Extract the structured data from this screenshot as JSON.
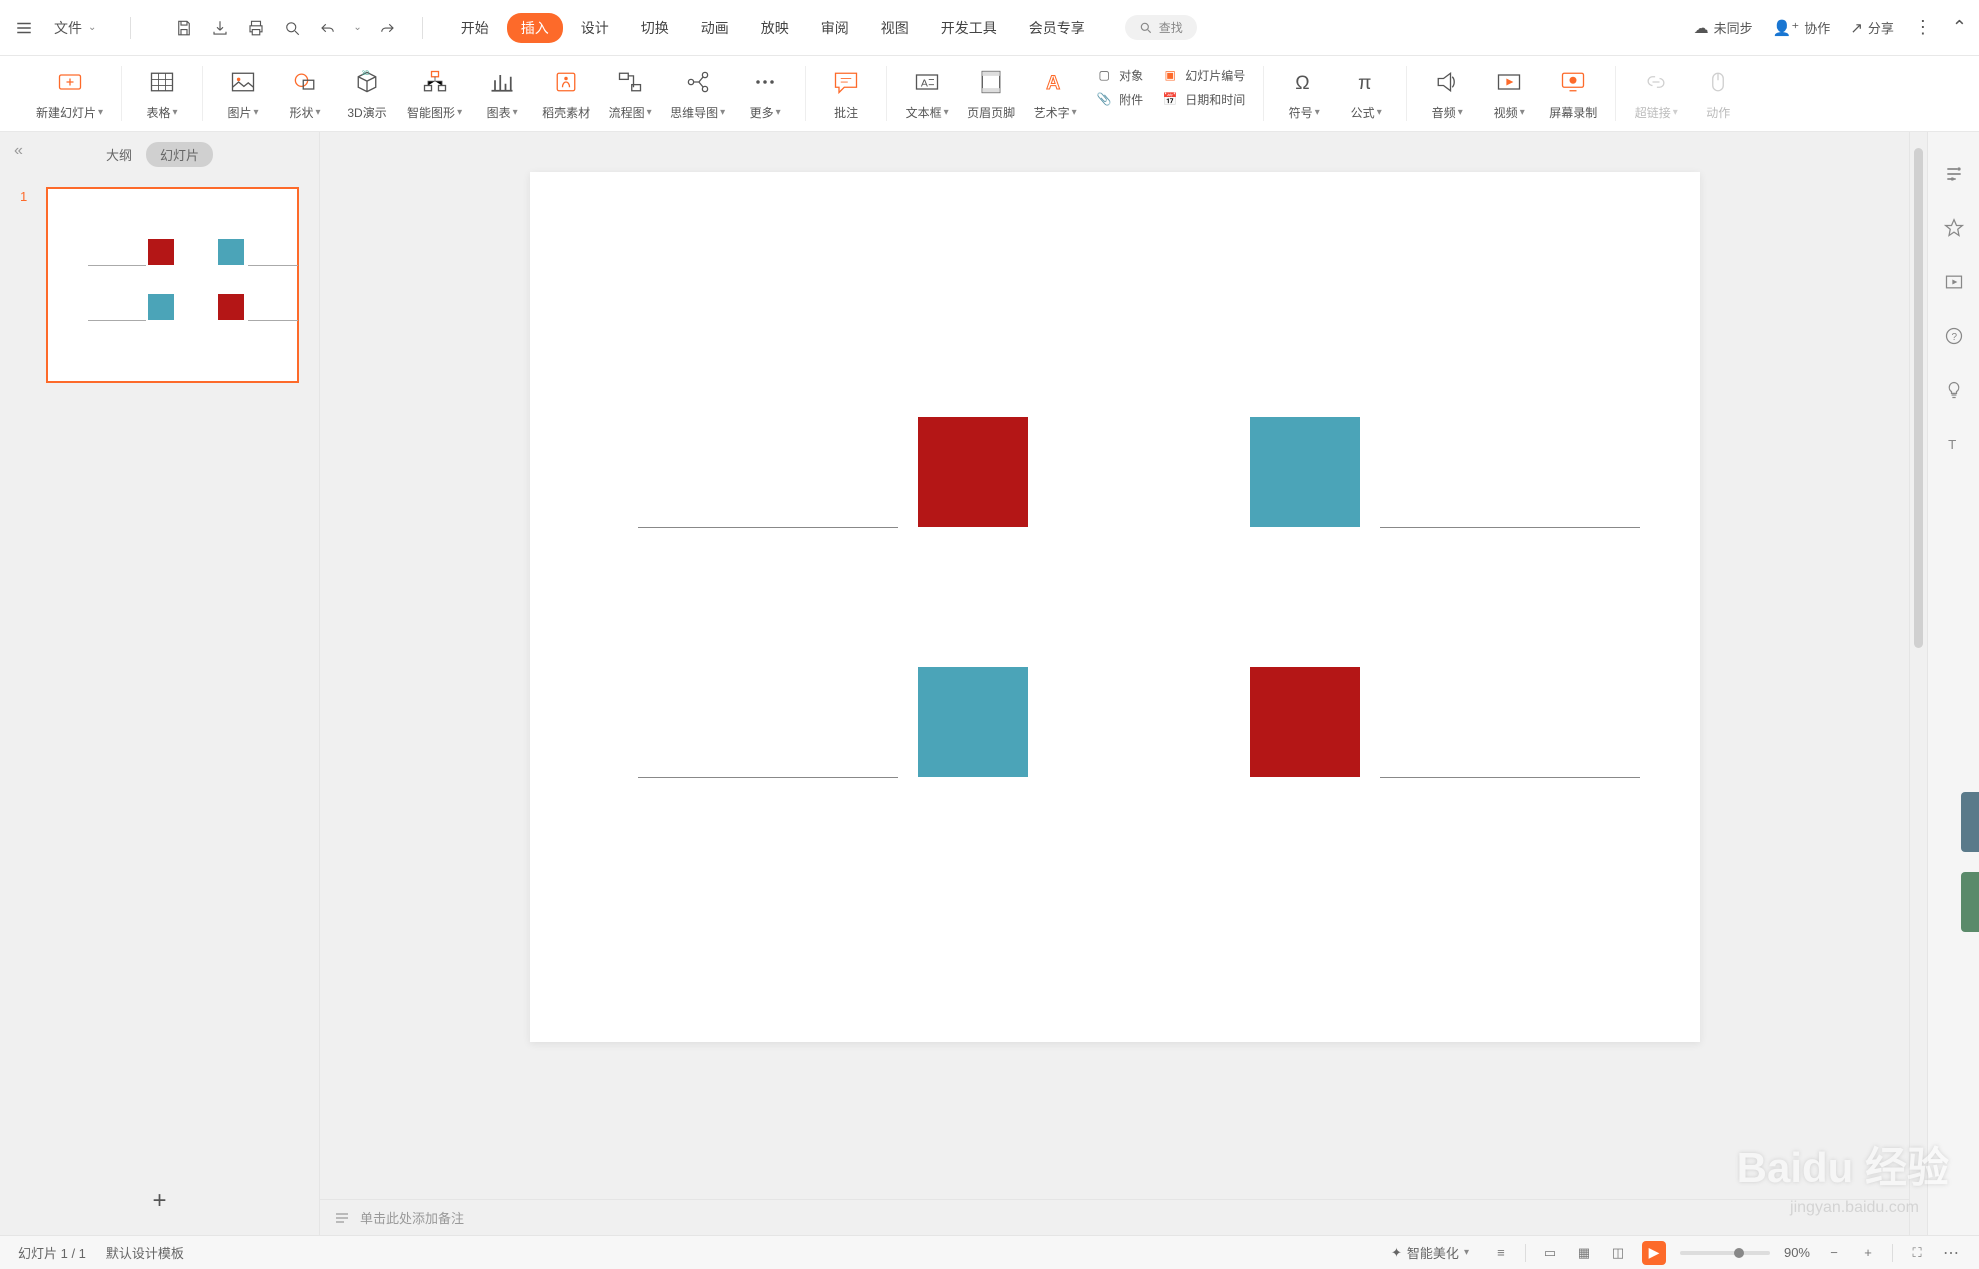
{
  "titlebar": {
    "file_menu": "文件",
    "sync": "未同步",
    "collab": "协作",
    "share": "分享"
  },
  "tabs": {
    "start": "开始",
    "insert": "插入",
    "design": "设计",
    "transition": "切换",
    "animation": "动画",
    "slideshow": "放映",
    "review": "审阅",
    "view": "视图",
    "devtools": "开发工具",
    "member": "会员专享"
  },
  "search": {
    "placeholder": "查找"
  },
  "ribbon": {
    "new_slide": "新建幻灯片",
    "table": "表格",
    "picture": "图片",
    "shape": "形状",
    "threeD": "3D演示",
    "smartart": "智能图形",
    "chart": "图表",
    "stock": "稻壳素材",
    "flowchart": "流程图",
    "mindmap": "思维导图",
    "more": "更多",
    "comment": "批注",
    "textbox": "文本框",
    "headerfooter": "页眉页脚",
    "wordart": "艺术字",
    "object": "对象",
    "slidenum": "幻灯片编号",
    "attachment": "附件",
    "datetime": "日期和时间",
    "symbol": "符号",
    "equation": "公式",
    "audio": "音频",
    "video": "视频",
    "screenrec": "屏幕录制",
    "hyperlink": "超链接",
    "action": "动作"
  },
  "slides_panel": {
    "outline": "大纲",
    "slides": "幻灯片",
    "slide1_num": "1"
  },
  "canvas": {
    "shapes": {
      "sq_red": "#b41616",
      "sq_teal": "#4ba4b8",
      "line_color": "#888888"
    }
  },
  "notes": {
    "placeholder": "单击此处添加备注"
  },
  "statusbar": {
    "slide_pos": "幻灯片 1 / 1",
    "template": "默认设计模板",
    "beautify": "智能美化",
    "zoom": "90%"
  },
  "watermark": {
    "logo": "Baidu 经验",
    "url": "jingyan.baidu.com"
  }
}
